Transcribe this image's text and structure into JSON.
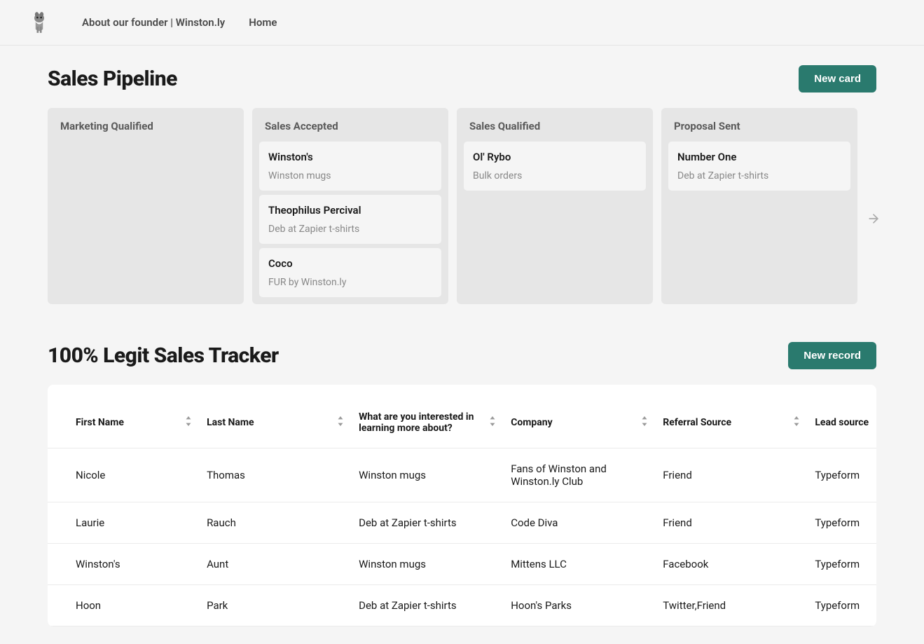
{
  "nav": {
    "links": [
      "About our founder | Winston.ly",
      "Home"
    ]
  },
  "pipeline": {
    "title": "Sales Pipeline",
    "new_button": "New card",
    "columns": [
      {
        "title": "Marketing Qualified",
        "cards": []
      },
      {
        "title": "Sales Accepted",
        "cards": [
          {
            "title": "Winston's",
            "subtitle": "Winston mugs"
          },
          {
            "title": "Theophilus Percival",
            "subtitle": "Deb at Zapier t-shirts"
          },
          {
            "title": "Coco",
            "subtitle": "FUR by Winston.ly"
          }
        ]
      },
      {
        "title": "Sales Qualified",
        "cards": [
          {
            "title": "Ol' Rybo",
            "subtitle": "Bulk orders"
          }
        ]
      },
      {
        "title": "Proposal Sent",
        "cards": [
          {
            "title": "Number One",
            "subtitle": "Deb at Zapier t-shirts"
          }
        ]
      }
    ]
  },
  "tracker": {
    "title": "100% Legit Sales Tracker",
    "new_button": "New record",
    "headers": [
      "First Name",
      "Last Name",
      "What are you interested in learning more about?",
      "Company",
      "Referral Source",
      "Lead source"
    ],
    "rows": [
      {
        "first": "Nicole",
        "last": "Thomas",
        "interest": "Winston mugs",
        "company": "Fans of Winston and Winston.ly Club",
        "referral": "Friend",
        "lead": "Typeform"
      },
      {
        "first": "Laurie",
        "last": "Rauch",
        "interest": "Deb at Zapier t-shirts",
        "company": "Code Diva",
        "referral": "Friend",
        "lead": "Typeform"
      },
      {
        "first": "Winston's",
        "last": "Aunt",
        "interest": "Winston mugs",
        "company": "Mittens LLC",
        "referral": "Facebook",
        "lead": "Typeform"
      },
      {
        "first": "Hoon",
        "last": "Park",
        "interest": "Deb at Zapier t-shirts",
        "company": "Hoon's Parks",
        "referral": "Twitter,Friend",
        "lead": "Typeform"
      }
    ]
  }
}
